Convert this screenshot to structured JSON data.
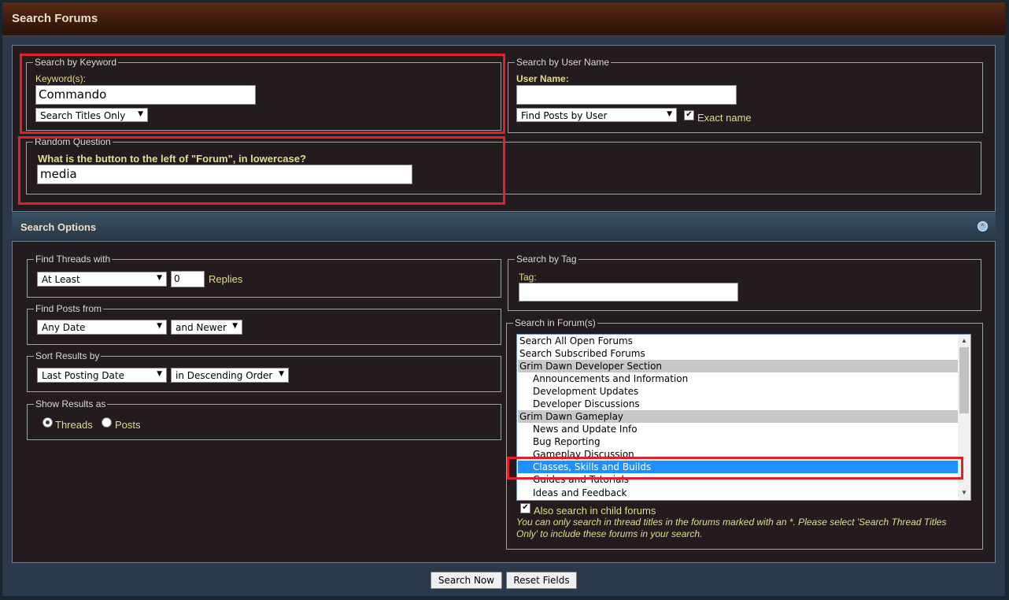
{
  "page_title": "Search Forums",
  "keyword_section": {
    "legend": "Search by Keyword",
    "label": "Keyword(s):",
    "value": "Commando",
    "mode_select": "Search Titles Only"
  },
  "user_section": {
    "legend": "Search by User Name",
    "label": "User Name:",
    "value": "",
    "mode_select": "Find Posts by User",
    "exact_name_label": "Exact name"
  },
  "question_section": {
    "legend": "Random Question",
    "question": "What is the button to the left of \"Forum\", in lowercase?",
    "answer": "media"
  },
  "options_header": "Search Options",
  "find_threads": {
    "legend": "Find Threads with",
    "qualifier": "At Least",
    "count": "0",
    "suffix": "Replies"
  },
  "find_posts": {
    "legend": "Find Posts from",
    "date": "Any Date",
    "direction": "and Newer"
  },
  "sort_results": {
    "legend": "Sort Results by",
    "field": "Last Posting Date",
    "order": "in Descending Order"
  },
  "show_results": {
    "legend": "Show Results as",
    "threads_label": "Threads",
    "posts_label": "Posts"
  },
  "tag_section": {
    "legend": "Search by Tag",
    "label": "Tag:",
    "value": ""
  },
  "forums_section": {
    "legend": "Search in Forum(s)",
    "options": [
      {
        "label": "Search All Open Forums",
        "type": "normal"
      },
      {
        "label": "Search Subscribed Forums",
        "type": "normal"
      },
      {
        "label": "Grim Dawn Developer Section",
        "type": "group"
      },
      {
        "label": "Announcements and Information",
        "type": "child"
      },
      {
        "label": "Development Updates",
        "type": "child"
      },
      {
        "label": "Developer Discussions",
        "type": "child"
      },
      {
        "label": "Grim Dawn Gameplay",
        "type": "group"
      },
      {
        "label": "News and Update Info",
        "type": "child"
      },
      {
        "label": "Bug Reporting",
        "type": "child"
      },
      {
        "label": "Gameplay Discussion",
        "type": "child"
      },
      {
        "label": "Classes, Skills and Builds",
        "type": "selected"
      },
      {
        "label": "Guides and Tutorials",
        "type": "child"
      },
      {
        "label": "Ideas and Feedback",
        "type": "child"
      }
    ],
    "child_forums_label": "Also search in child forums",
    "note": "You can only search in thread titles in the forums marked with an *. Please select 'Search Thread Titles Only' to include these forums in your search."
  },
  "buttons": {
    "search": "Search Now",
    "reset": "Reset Fields"
  },
  "colors": {
    "highlight": "#e2202a",
    "selected": "#1e90ff",
    "label": "#e6dc8c"
  }
}
